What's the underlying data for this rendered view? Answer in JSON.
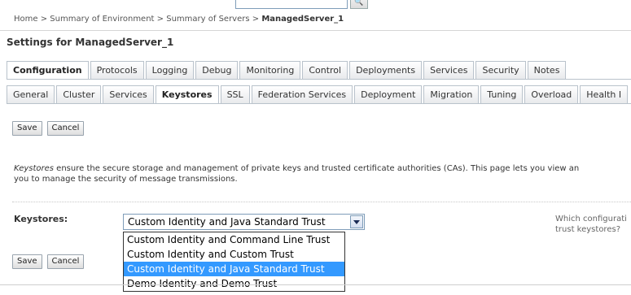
{
  "breadcrumb": {
    "items": [
      "Home",
      "Summary of Environment",
      "Summary of Servers"
    ],
    "separator": ">",
    "current": "ManagedServer_1"
  },
  "page": {
    "title": "Settings for ManagedServer_1"
  },
  "top_tabs": [
    {
      "label": "Configuration",
      "active": true
    },
    {
      "label": "Protocols"
    },
    {
      "label": "Logging"
    },
    {
      "label": "Debug"
    },
    {
      "label": "Monitoring"
    },
    {
      "label": "Control"
    },
    {
      "label": "Deployments"
    },
    {
      "label": "Services"
    },
    {
      "label": "Security"
    },
    {
      "label": "Notes"
    }
  ],
  "sub_tabs": [
    {
      "label": "General"
    },
    {
      "label": "Cluster"
    },
    {
      "label": "Services"
    },
    {
      "label": "Keystores",
      "active": true
    },
    {
      "label": "SSL"
    },
    {
      "label": "Federation Services"
    },
    {
      "label": "Deployment"
    },
    {
      "label": "Migration"
    },
    {
      "label": "Tuning"
    },
    {
      "label": "Overload"
    },
    {
      "label": "Health I"
    }
  ],
  "buttons": {
    "save": "Save",
    "cancel": "Cancel"
  },
  "description": {
    "term": "Keystores",
    "text": " ensure the secure storage and management of private keys and trusted certificate authorities (CAs). This page lets you view an",
    "line2": "you to manage the security of message transmissions."
  },
  "keystores_field": {
    "label": "Keystores:",
    "selected": "Custom Identity and Java Standard Trust",
    "options": [
      "Custom Identity and Command Line Trust",
      "Custom Identity and Custom Trust",
      "Custom Identity and Java Standard Trust",
      "Demo Identity and Demo Trust"
    ],
    "highlighted_index": 2,
    "help_line1": "Which configurati",
    "help_line2": "trust keystores?"
  },
  "colors": {
    "selection": "#3399ff",
    "tab_border": "#b9c2cb"
  }
}
